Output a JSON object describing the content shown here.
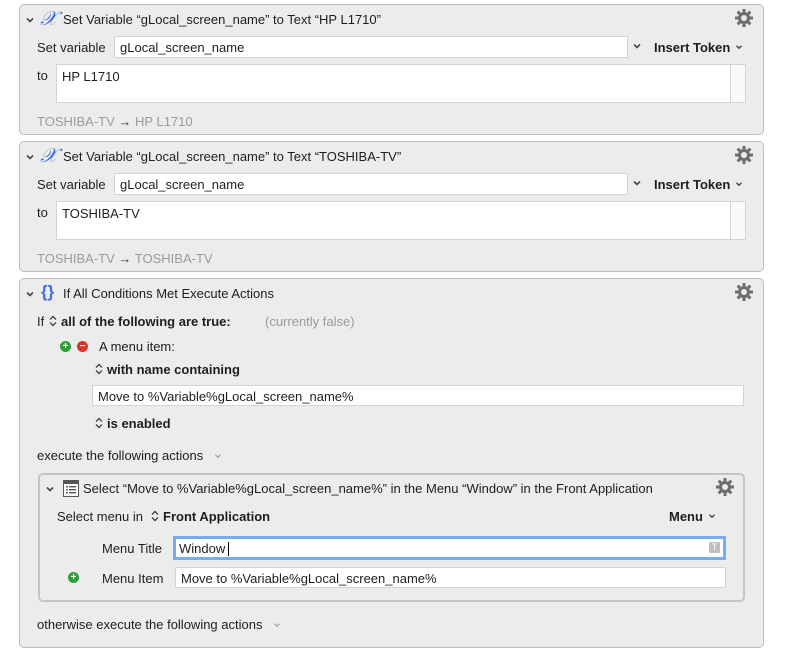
{
  "actions": [
    {
      "title": "Set Variable “gLocal_screen_name” to Text “HP L1710”",
      "set_variable_label": "Set variable",
      "variable_value": "gLocal_screen_name",
      "insert_token_label": "Insert Token",
      "to_label": "to",
      "text_value": "HP L1710",
      "preview_from": "TOSHIBA-TV",
      "preview_arrow": "→",
      "preview_to": "HP L1710"
    },
    {
      "title": "Set Variable “gLocal_screen_name” to Text “TOSHIBA-TV”",
      "set_variable_label": "Set variable",
      "variable_value": "gLocal_screen_name",
      "insert_token_label": "Insert Token",
      "to_label": "to",
      "text_value": "TOSHIBA-TV",
      "preview_from": "TOSHIBA-TV",
      "preview_arrow": "→",
      "preview_to": "TOSHIBA-TV"
    }
  ],
  "if_action": {
    "title": "If All Conditions Met Execute Actions",
    "if_label": "If",
    "condition_mode": "all of the following are true:",
    "status": "(currently false)",
    "condition_label": "A menu item:",
    "name_match": "with name containing",
    "name_value": "Move to %Variable%gLocal_screen_name%",
    "enabled_state": "is enabled",
    "execute_label": "execute the following actions",
    "otherwise_label": "otherwise execute the following actions"
  },
  "select_menu_action": {
    "title": "Select “Move to %Variable%gLocal_screen_name%” in the Menu “Window” in the Front Application",
    "select_menu_label": "Select menu in",
    "app_value": "Front Application",
    "menu_dropdown": "Menu",
    "menu_title_label": "Menu Title",
    "menu_title_value": "Window",
    "token_badge": "T",
    "menu_item_label": "Menu Item",
    "menu_item_value": "Move to %Variable%gLocal_screen_name%"
  },
  "colors": {
    "panel_bg": "#ececec",
    "focus_ring": "#4a90e2",
    "variable_icon": "#3c6fd8",
    "add_green": "#2e9d3a",
    "remove_red": "#d9332c"
  }
}
